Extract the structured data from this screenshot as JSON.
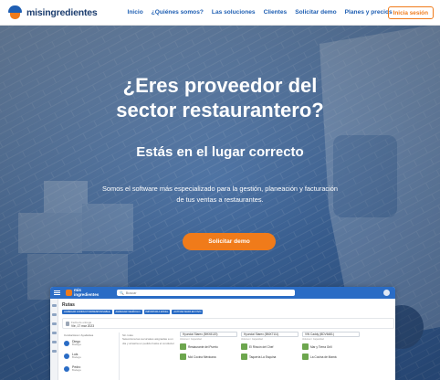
{
  "brand": {
    "name": "misingredientes"
  },
  "nav": {
    "links": [
      "Inicio",
      "¿Quiénes somos?",
      "Las soluciones",
      "Clientes",
      "Solicitar demo",
      "Planes y precios"
    ],
    "login": "Inicia sesión"
  },
  "hero": {
    "title_line1": "¿Eres proveedor del",
    "title_line2": "sector restaurantero?",
    "subtitle": "Estás en el lugar correcto",
    "description": "Somos el software más especializado para la gestión, planeación y facturación de tus ventas a restaurantes.",
    "cta": "Solicitar demo"
  },
  "app_preview": {
    "logo_line1": "mis",
    "logo_line2": "ingredientes",
    "search_placeholder": "Buscar",
    "page_title": "Rutas",
    "actions": [
      "AGREGAR CONDUCTOR/RESPONSABLE",
      "AGREGAR VEHÍCULO",
      "IMPORTAR A EXCEL",
      "ACTIVAR MAPA EN VIVO"
    ],
    "date_label": "Fecha de entrega",
    "date_value": "Vie, 17 mar 2023",
    "list_header": "Conductores / Ayudantes",
    "drivers": [
      {
        "name": "Diego",
        "sub": "Bodega"
      },
      {
        "name": "Luis",
        "sub": "Bodega"
      },
      {
        "name": "Pedro",
        "sub": "Bodega"
      }
    ],
    "info_label": "Sin rutas",
    "info_text": "Selecciona las sucursales asignadas a un día y arrastra un pedido hasta el conductor",
    "columns": [
      {
        "select": "Hyundai Starex (BHX8120)",
        "note": "Volumen / Capacidad",
        "cards": [
          "Restaurante del Puerto",
          "Mol Cocina Mexicana"
        ]
      },
      {
        "select": "Hyundai Starex (BMX7111)",
        "note": "Volumen / Capacidad",
        "cards": [
          "El Rincón del Chef",
          "Taquería La Esquina"
        ]
      },
      {
        "select": "VW Caddy (BDV6481)",
        "note": "Volumen / Capacidad",
        "cards": [
          "Mar y Tierra Grill",
          "La Cocina de Mamá"
        ]
      }
    ]
  }
}
